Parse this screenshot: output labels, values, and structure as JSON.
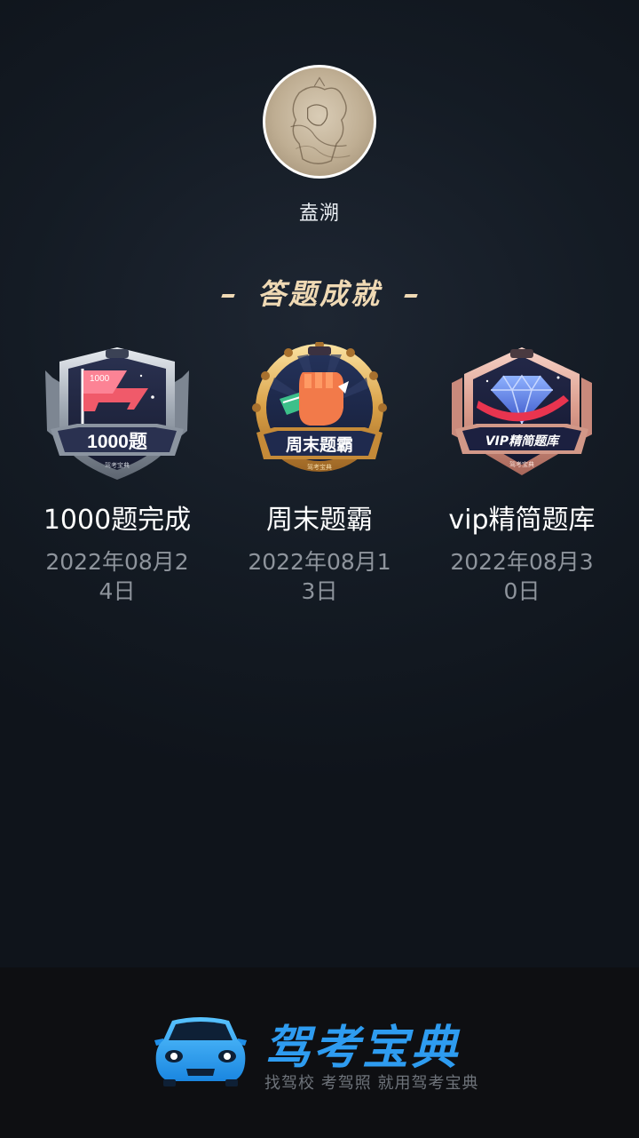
{
  "profile": {
    "username": "盍溯"
  },
  "section": {
    "title": "答题成就"
  },
  "badges": [
    {
      "name": "1000题完成",
      "date": "2022年08月24日",
      "art_label": "1000题",
      "flag_label": "1000",
      "brand_small": "驾考宝典",
      "icon": "flag-shield-badge-icon"
    },
    {
      "name": "周末题霸",
      "date": "2022年08月13日",
      "art_label": "周末题霸",
      "brand_small": "驾考宝典",
      "icon": "fist-gold-badge-icon"
    },
    {
      "name": "vip精简题库",
      "date": "2022年08月30日",
      "art_label": "VIP精简题库",
      "brand_small": "驾考宝典",
      "icon": "diamond-rose-badge-icon"
    }
  ],
  "footer": {
    "brand_name": "驾考宝典",
    "slogan": "找驾校 考驾照 就用驾考宝典",
    "logo_icon": "blue-car-logo-icon"
  },
  "colors": {
    "title_gold": "#efd9b4",
    "date_gray": "#8e949c",
    "brand_blue": "#2e9cf0",
    "footer_bg": "#0e0f12"
  }
}
